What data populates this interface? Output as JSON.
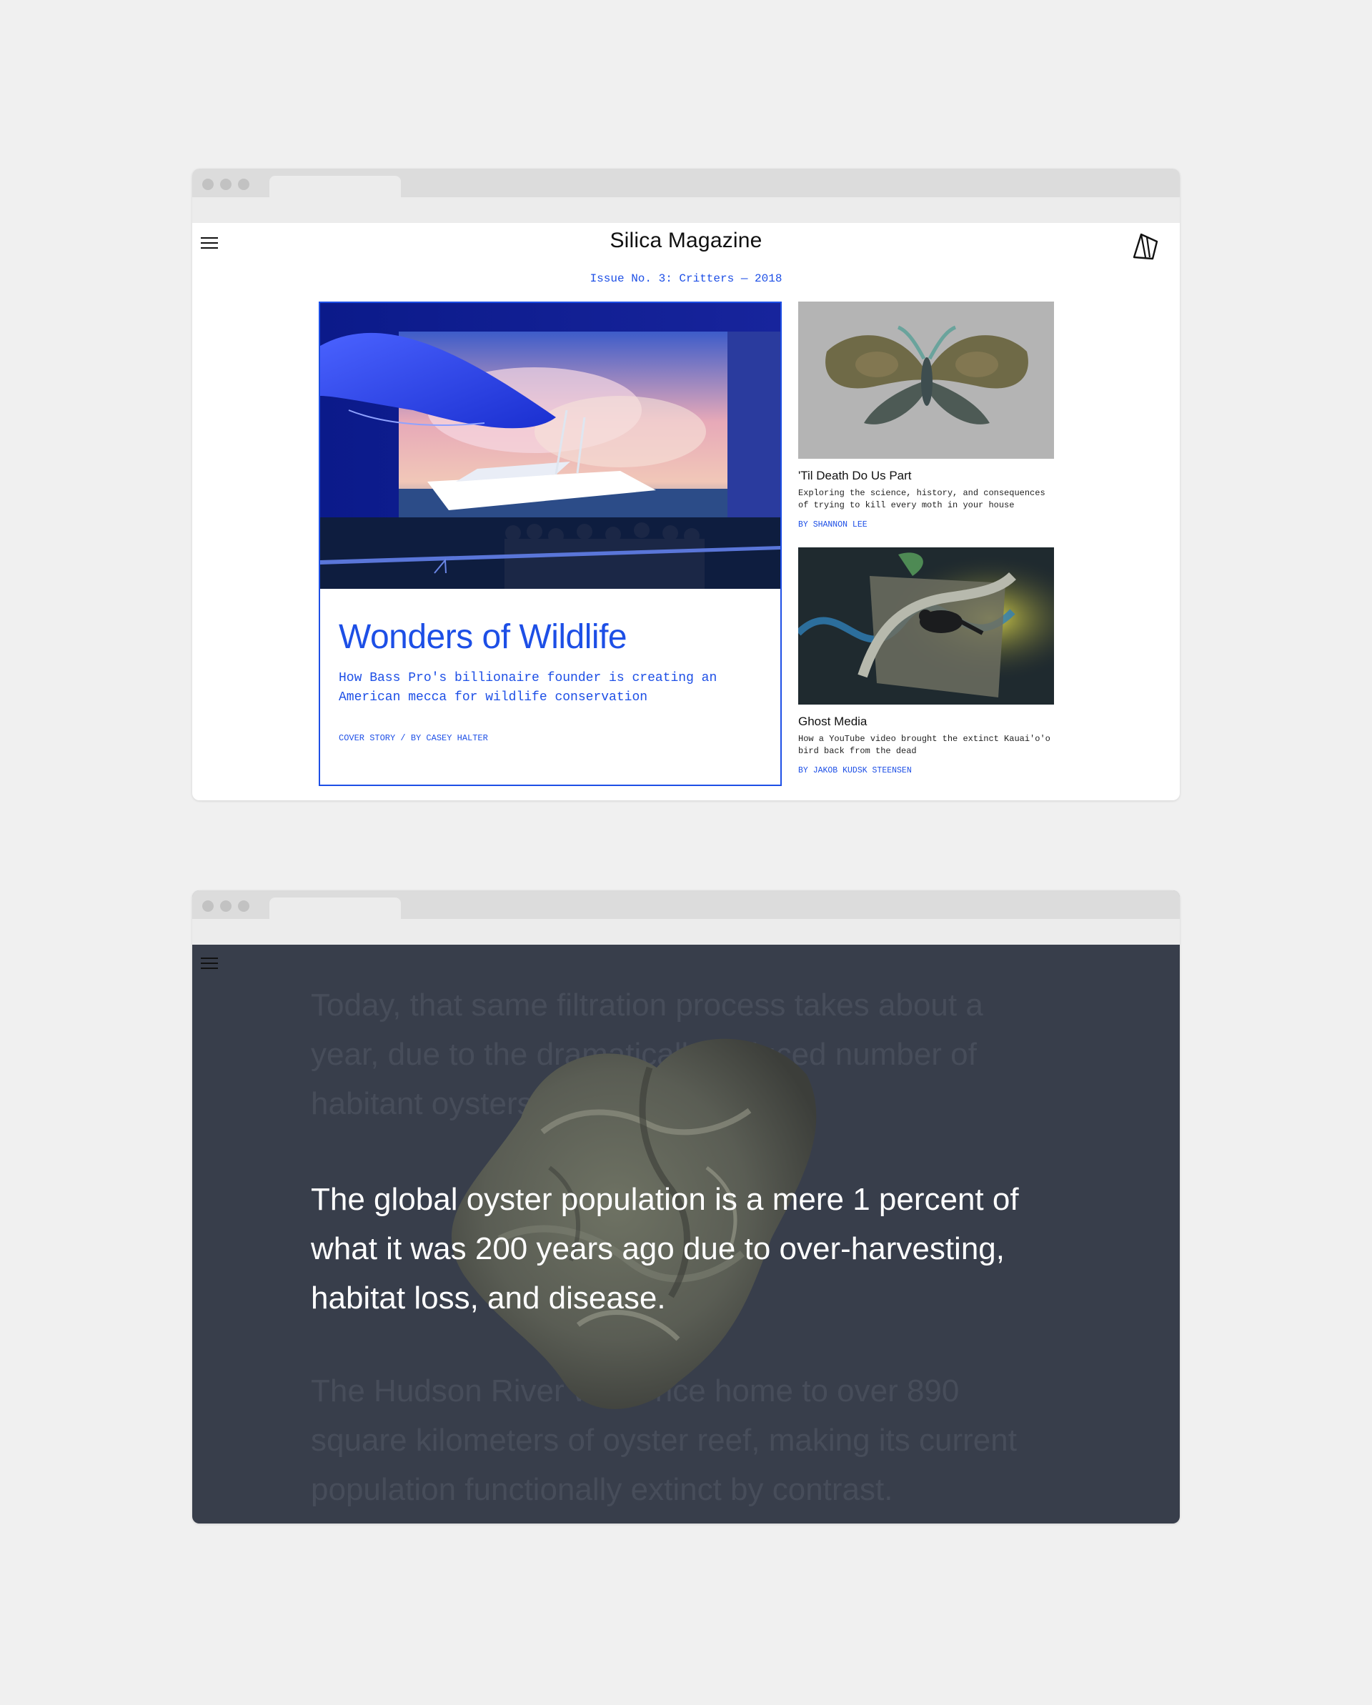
{
  "browser_top": {
    "site_title": "Silica Magazine",
    "menu_icon": "hamburger-icon",
    "logo_icon": "silica-logo-icon",
    "issue_line": "Issue No. 3: Critters — 2018",
    "cover_story": {
      "title": "Wonders of Wildlife",
      "dek": "How Bass Pro's billionaire founder is creating an American mecca for wildlife conservation",
      "byline": "COVER STORY / BY CASEY HALTER"
    },
    "side_stories": [
      {
        "title": "'Til Death Do Us Part",
        "dek": "Exploring the science, history, and consequences of trying to kill every moth in your house",
        "byline": "BY SHANNON LEE"
      },
      {
        "title": "Ghost Media",
        "dek": "How a YouTube video brought the extinct Kauai'o'o bird back from the dead",
        "byline": "BY JAKOB KUDSK STEENSEN"
      }
    ]
  },
  "browser_bottom": {
    "menu_icon": "hamburger-icon",
    "faded_paragraph_1": "Today, that same filtration process takes about a year, due to the dramatically reduced number of habitant oysters.",
    "highlight_paragraph": "The global oyster population is a mere 1 percent of what it was 200 years ago due to over-harvesting, habitat loss, and disease.",
    "faded_paragraph_2": "The Hudson River was once home to over 890 square kilometers of oyster reef, making its current population functionally extinct by contrast."
  },
  "colors": {
    "accent_blue": "#1d4fe6",
    "page_background": "#f0f0f0",
    "dark_background": "#383e4b",
    "faded_text": "#474d5a"
  }
}
